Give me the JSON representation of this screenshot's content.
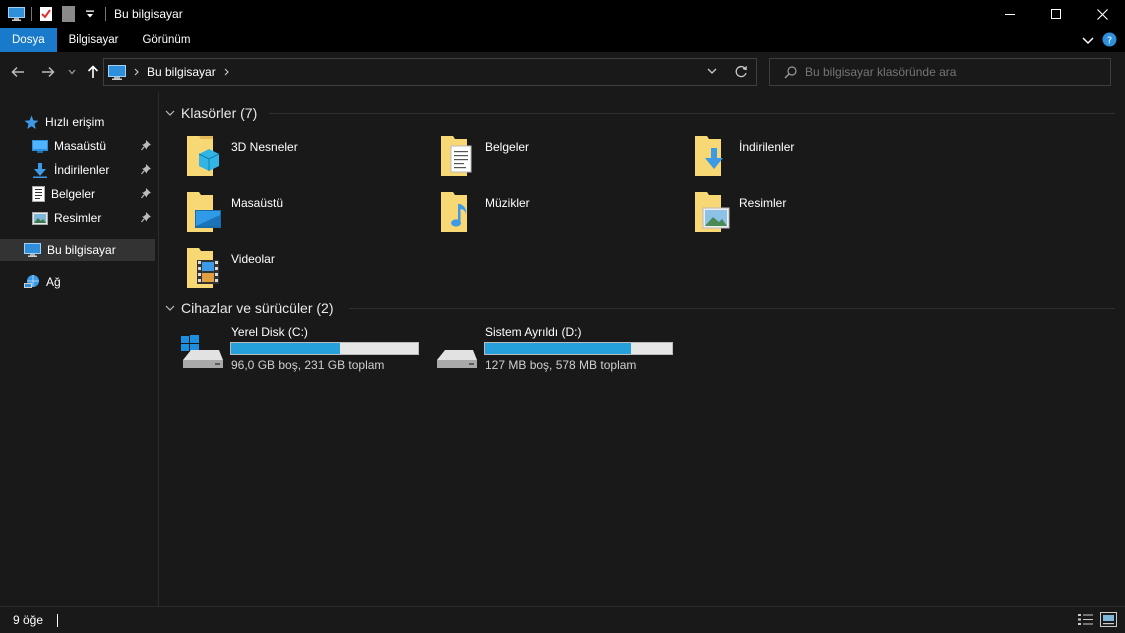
{
  "window": {
    "title": "Bu bilgisayar",
    "controls": [
      "minimize-icon",
      "maximize-icon",
      "close-icon"
    ]
  },
  "ribbon": {
    "tabs": [
      {
        "label": "Dosya",
        "active": true
      },
      {
        "label": "Bilgisayar",
        "active": false
      },
      {
        "label": "Görünüm",
        "active": false
      }
    ]
  },
  "address": {
    "crumb": "Bu bilgisayar",
    "search_placeholder": "Bu bilgisayar klasöründe ara"
  },
  "sidebar": {
    "items": [
      {
        "label": "Hızlı erişim",
        "icon": "star-icon"
      },
      {
        "label": "Masaüstü",
        "icon": "desktop-icon",
        "pinned": true
      },
      {
        "label": "İndirilenler",
        "icon": "download-icon",
        "pinned": true
      },
      {
        "label": "Belgeler",
        "icon": "documents-icon",
        "pinned": true
      },
      {
        "label": "Resimler",
        "icon": "pictures-icon",
        "pinned": true
      },
      {
        "label": "Bu bilgisayar",
        "icon": "computer-icon",
        "selected": true
      },
      {
        "label": "Ağ",
        "icon": "network-icon"
      }
    ]
  },
  "folders": {
    "heading": "Klasörler (7)",
    "items": [
      {
        "name": "3D Nesneler",
        "icon": "3d-objects-folder-icon"
      },
      {
        "name": "Belgeler",
        "icon": "documents-folder-icon"
      },
      {
        "name": "İndirilenler",
        "icon": "downloads-folder-icon"
      },
      {
        "name": "Masaüstü",
        "icon": "desktop-folder-icon"
      },
      {
        "name": "Müzikler",
        "icon": "music-folder-icon"
      },
      {
        "name": "Resimler",
        "icon": "pictures-folder-icon"
      },
      {
        "name": "Videolar",
        "icon": "videos-folder-icon"
      }
    ]
  },
  "drives": {
    "heading": "Cihazlar ve sürücüler (2)",
    "items": [
      {
        "name": "Yerel Disk (C:)",
        "info": "96,0 GB boş, 231 GB toplam",
        "used_fraction": 0.584,
        "icon": "system-drive-icon"
      },
      {
        "name": "Sistem Ayrıldı (D:)",
        "info": "127 MB boş, 578 MB toplam",
        "used_fraction": 0.78,
        "icon": "drive-icon"
      }
    ]
  },
  "status": {
    "count": "9 öğe"
  },
  "colors": {
    "accent": "#1979ca",
    "bar_fill": "#26a0da",
    "background": "#191919",
    "folder": "#f8d775"
  }
}
